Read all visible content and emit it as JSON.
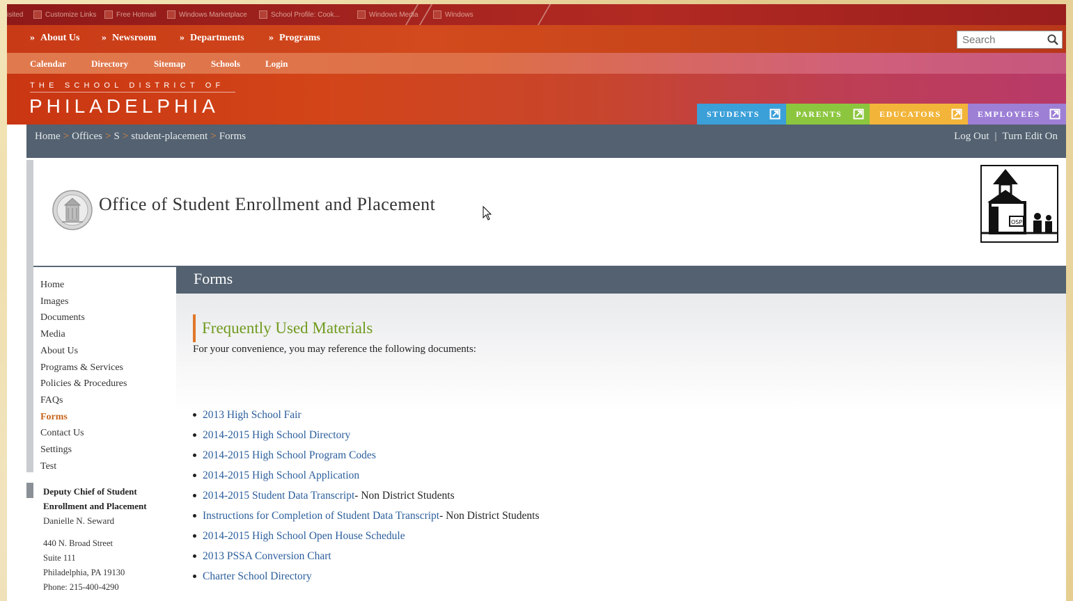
{
  "favorites": [
    {
      "label": "isited"
    },
    {
      "label": "Customize Links"
    },
    {
      "label": "Free Hotmail"
    },
    {
      "label": "Windows Marketplace"
    },
    {
      "label": "School Profile: Cook..."
    },
    {
      "label": "Windows Media"
    },
    {
      "label": "Windows"
    }
  ],
  "main_nav": {
    "items": [
      {
        "prefix": "»",
        "label": "About Us"
      },
      {
        "prefix": "»",
        "label": "Newsroom"
      },
      {
        "prefix": "»",
        "label": "Departments"
      },
      {
        "prefix": "»",
        "label": "Programs"
      }
    ],
    "search_placeholder": "Search"
  },
  "sub_nav": {
    "items": [
      {
        "label": "Calendar"
      },
      {
        "label": "Directory"
      },
      {
        "label": "Sitemap"
      },
      {
        "label": "Schools"
      },
      {
        "label": "Login"
      }
    ]
  },
  "banner": {
    "kicker": "THE SCHOOL DISTRICT OF",
    "name": "PHILADELPHIA",
    "audiences": [
      {
        "label": "STUDENTS",
        "color": "#3b9fd8"
      },
      {
        "label": "PARENTS",
        "color": "#8cc63e"
      },
      {
        "label": "EDUCATORS",
        "color": "#f2b53a"
      },
      {
        "label": "EMPLOYEES",
        "color": "#9d7fd6"
      }
    ]
  },
  "breadcrumb": {
    "items": [
      {
        "label": "Home"
      },
      {
        "label": "Offices"
      },
      {
        "label": "S"
      },
      {
        "label": "student-placement"
      },
      {
        "label": "Forms"
      }
    ],
    "separator": ">",
    "log_out": "Log Out",
    "pipe": "|",
    "edit": "Turn Edit On"
  },
  "office": {
    "title": "Office of Student Enrollment and Placement",
    "logo_text": "OSP"
  },
  "left_nav": {
    "items": [
      {
        "label": "Home",
        "active": false
      },
      {
        "label": "Images",
        "active": false
      },
      {
        "label": "Documents",
        "active": false
      },
      {
        "label": "Media",
        "active": false
      },
      {
        "label": "About Us",
        "active": false
      },
      {
        "label": "Programs & Services",
        "active": false
      },
      {
        "label": "Policies & Procedures",
        "active": false
      },
      {
        "label": "FAQs",
        "active": false
      },
      {
        "label": "Forms",
        "active": true
      },
      {
        "label": "Contact Us",
        "active": false
      },
      {
        "label": "Settings",
        "active": false
      },
      {
        "label": "Test",
        "active": false
      }
    ]
  },
  "contact": {
    "role": "Deputy Chief of Student Enrollment and Placement",
    "person": "Danielle N. Seward",
    "address_lines": [
      "440 N. Broad Street",
      "Suite 111",
      "Philadelphia, PA 19130",
      "Phone: 215-400-4290"
    ]
  },
  "content": {
    "heading": "Forms",
    "section_title": "Frequently Used Materials",
    "intro": "For your convenience, you may reference the following documents:",
    "links": [
      {
        "label": "2013 High School Fair",
        "suffix": ""
      },
      {
        "label": "2014-2015 High School Directory",
        "suffix": ""
      },
      {
        "label": "2014-2015 High School Program Codes",
        "suffix": ""
      },
      {
        "label": "2014-2015 High School Application",
        "suffix": ""
      },
      {
        "label": "2014-2015 Student Data Transcript",
        "suffix": " - Non District Students"
      },
      {
        "label": "Instructions for Completion of Student Data Transcript",
        "suffix": " - Non District Students"
      },
      {
        "label": "2014-2015 High School Open House Schedule",
        "suffix": ""
      },
      {
        "label": "2013 PSSA Conversion Chart",
        "suffix": ""
      },
      {
        "label": "Charter School Directory",
        "suffix": ""
      }
    ]
  },
  "colors": {
    "accent_orange": "#e0782a",
    "section_green": "#6f9a1e",
    "link_blue": "#2a5d9b",
    "slate": "#536170"
  },
  "icons": {
    "search": "search-icon",
    "external": "external-link-icon",
    "seal": "district-seal-icon",
    "logo": "osp-logo-icon",
    "cursor": "mouse-cursor-icon"
  }
}
